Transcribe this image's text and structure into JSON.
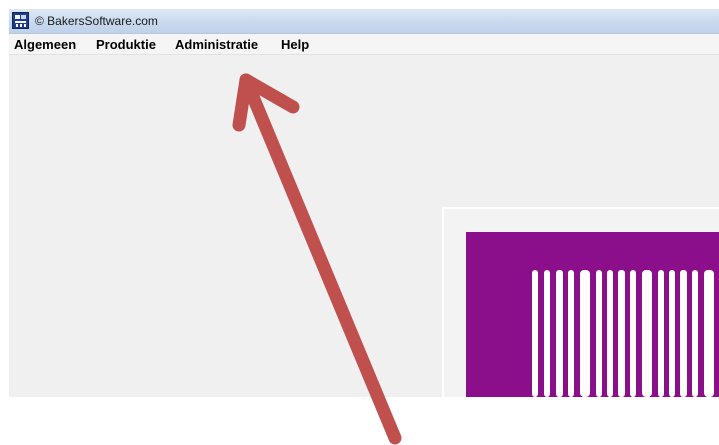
{
  "window": {
    "title": "© BakersSoftware.com",
    "icon": "bakers-logo-icon",
    "background": "#f0f0f0"
  },
  "menubar": {
    "items": [
      {
        "label": "Algemeen"
      },
      {
        "label": "Produktie"
      },
      {
        "label": "Administratie"
      },
      {
        "label": "Help"
      }
    ]
  },
  "splash": {
    "logo_color": "#8b0f8b",
    "stripe_color": "#ffffff"
  },
  "annotation": {
    "icon": "red-arrow-pointer",
    "color": "#c0504d"
  }
}
